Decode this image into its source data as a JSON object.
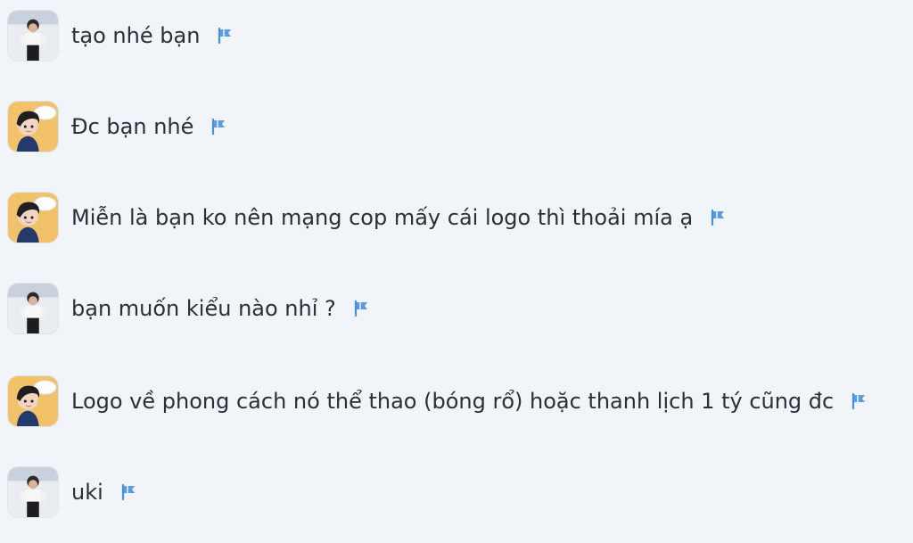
{
  "messages": [
    {
      "avatar": "user-avatar-photo",
      "text": "tạo nhé bạn",
      "icon": "flag-icon"
    },
    {
      "avatar": "cartoon-avatar",
      "text": "Đc bạn nhé",
      "icon": "flag-icon"
    },
    {
      "avatar": "cartoon-avatar",
      "text": "Miễn là bạn ko nên mạng cop mấy cái logo thì thoải mía ạ",
      "icon": "flag-icon"
    },
    {
      "avatar": "user-avatar-photo",
      "text": "bạn muốn kiểu nào nhỉ ?",
      "icon": "flag-icon"
    },
    {
      "avatar": "cartoon-avatar",
      "text": "Logo về phong cách nó thể thao (bóng rổ) hoặc thanh lịch 1 tý cũng đc",
      "icon": "flag-icon"
    },
    {
      "avatar": "user-avatar-photo",
      "text": "uki",
      "icon": "flag-icon"
    }
  ],
  "colors": {
    "background": "#f1f4f9",
    "text": "#2c2f36",
    "flag": "#4a90e2"
  }
}
